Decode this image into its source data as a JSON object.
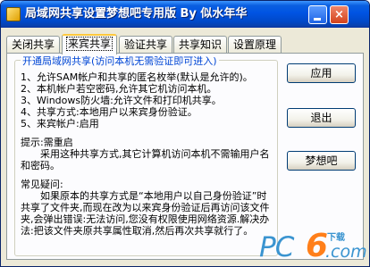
{
  "window": {
    "title": "局域网共享设置梦想吧专用版 By 似水年华",
    "minimize_glyph": "",
    "close_glyph": "×"
  },
  "tabs": [
    {
      "label": "关闭共享",
      "active": false
    },
    {
      "label": "来宾共享",
      "active": true
    },
    {
      "label": "验证共享",
      "active": false
    },
    {
      "label": "共享知识",
      "active": false
    },
    {
      "label": "设置原理",
      "active": false
    }
  ],
  "group": {
    "legend": "开通局域网共享(访问本机无需验证即可进入)",
    "lines": [
      "1、允许SAM帐户和共享的匿名枚举(默认是允许的)。",
      "2、本机帐户若空密码,允许其它机访问本机。",
      "3、Windows防火墙:允许文件和打印机共享。",
      "4、共享方式:本地用户以来宾身份验证。",
      "5、来宾帐户:启用",
      "提示:需重启",
      "　　采用这种共享方式,其它计算机访问本机不需输用户名和密码。",
      "常见疑问:",
      "　　如果原本的共享方式是“本地用户以自己身份验证”时共享了文件夹,而现在改为以来宾身份验证后再访问该文件夹,会弹出错误:无法访问,您没有权限使用网络资源.解决办法:把该文件夹原共享属性取消,然后再次共享就行了。"
    ]
  },
  "buttons": {
    "apply": "应用",
    "exit": "退出",
    "dream": "梦想吧"
  },
  "watermark": {
    "pc": "PC",
    "six": "6",
    "download": "下载",
    "com": ".com"
  },
  "colors": {
    "titlebar": "#0054e3",
    "legend_text": "#0046d5",
    "active_tab_accent": "#ffc83c",
    "watermark_blue": "#3a94d0",
    "watermark_orange": "#ff7f1a"
  }
}
